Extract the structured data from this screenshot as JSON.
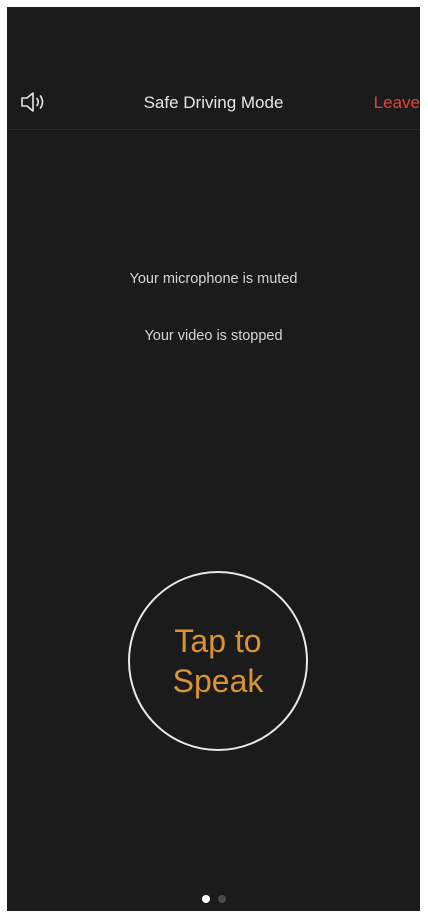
{
  "header": {
    "speaker_icon": "speaker-volume-icon",
    "title": "Safe Driving Mode",
    "leave_label": "Leave"
  },
  "status": {
    "microphone": "Your microphone is muted",
    "video": "Your video is stopped"
  },
  "speak_button": {
    "label": "Tap to Speak"
  },
  "pager": {
    "page_count": 2,
    "current_page": 1
  },
  "colors": {
    "background": "#1b1b1b",
    "title_text": "#e6e6e6",
    "leave_red": "#e0453c",
    "speak_orange": "#dc9433",
    "circle_border": "#e9e9e9",
    "dot_active": "#ffffff",
    "dot_inactive": "#4a4a4a"
  }
}
